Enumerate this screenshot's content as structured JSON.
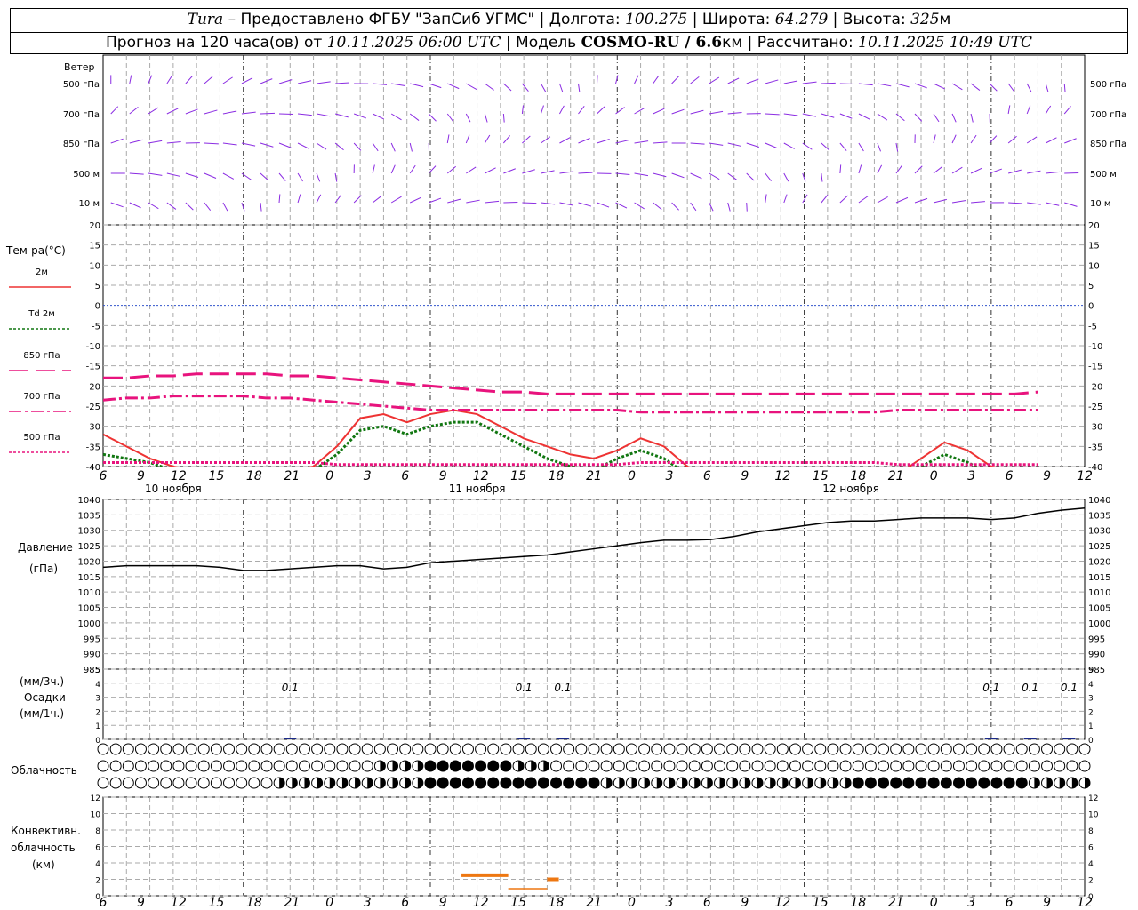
{
  "header": {
    "station": "Tura",
    "provider": " – Предоставлено ФГБУ \"ЗапСиб УГМС\" | Долгота: ",
    "lon": "100.275",
    "lat_label": " | Широта: ",
    "lat": "64.279",
    "alt_label": " | Высота: ",
    "alt": "325",
    "alt_unit": "м",
    "forecast_prefix": "Прогноз на 120 часа(ов) от ",
    "forecast_from": "10.11.2025 06:00 UTC",
    "model_prefix": " | Модель ",
    "model": "COSMO-RU / 6.6",
    "model_unit": "км",
    "calc_prefix": " | Рассчитано: ",
    "calc_time": "10.11.2025 10:49 UTC"
  },
  "colors": {
    "wind": "#8a2be2",
    "t2m": "#ee3333",
    "td2m": "#117711",
    "t850": "#e8137d",
    "t700": "#e8137d",
    "t500": "#e8137d",
    "pressure": "#000000",
    "precip": "#1a2a8a",
    "conv": "#ee7711",
    "grid": "#999999",
    "zero_line": "#3355cc"
  },
  "time_axis": {
    "hours": [
      "6",
      "9",
      "12",
      "15",
      "18",
      "21",
      "0",
      "3",
      "6",
      "9",
      "12",
      "15",
      "18",
      "21",
      "0",
      "3",
      "6",
      "9",
      "12",
      "15",
      "18",
      "21",
      "0",
      "3",
      "6",
      "9",
      "12"
    ],
    "dates": [
      "10 ноября",
      "11 ноября",
      "12 ноября"
    ]
  },
  "wind_panel": {
    "title": "Ветер",
    "levels": [
      "500 гПа",
      "700 гПа",
      "850 гПа",
      "500 м",
      "10  м"
    ]
  },
  "temp_panel": {
    "title": "Тем-ра(°C)",
    "legend": [
      {
        "label": "2м",
        "key": "t2m",
        "style": "solid"
      },
      {
        "label": "Td  2м",
        "key": "td2m",
        "style": "dotted"
      },
      {
        "label": "850 гПа",
        "key": "t850",
        "style": "solid"
      },
      {
        "label": "700 гПа",
        "key": "t700",
        "style": "dashdot"
      },
      {
        "label": "500 гПа",
        "key": "t500",
        "style": "dotted"
      }
    ],
    "yticks": [
      "20",
      "15",
      "10",
      "5",
      "0",
      "-5",
      "-10",
      "-15",
      "-20",
      "-25",
      "-30",
      "-35",
      "-40"
    ]
  },
  "pressure_panel": {
    "title_line1": "Давление",
    "title_line2": "(гПа)",
    "yticks": [
      "1040",
      "1035",
      "1030",
      "1025",
      "1020",
      "1015",
      "1010",
      "1005",
      "1000",
      "995",
      "990",
      "985"
    ]
  },
  "precip_panel": {
    "title_line1": "(мм/3ч.)",
    "title_line2": "Осадки",
    "title_line3": "(мм/1ч.)",
    "yticks": [
      "5",
      "4",
      "3",
      "2",
      "1",
      "0"
    ],
    "labels": [
      "0.1",
      "0.1",
      "0.1",
      "0.1",
      "0.1",
      "0.1"
    ]
  },
  "cloud_panel": {
    "title": "Облачность"
  },
  "conv_panel": {
    "title_line1": "Конвективн.",
    "title_line2": "облачность",
    "title_line3": "(км)",
    "yticks": [
      "12",
      "10",
      "8",
      "6",
      "4",
      "2",
      "0"
    ]
  },
  "chart_data": [
    {
      "type": "line",
      "title": "Тем-ра(°C)",
      "x": [
        0,
        3,
        6,
        9,
        12,
        15,
        18,
        21,
        24,
        27,
        30,
        33,
        36,
        39,
        42,
        45,
        48,
        51,
        54,
        57,
        60,
        63,
        66,
        69,
        72,
        75,
        78,
        81,
        84,
        87,
        90,
        93,
        96,
        99,
        102,
        105,
        108,
        111,
        114,
        117,
        120
      ],
      "ylim": [
        -40,
        20
      ],
      "series": [
        {
          "name": "2м",
          "key": "t2m",
          "values": [
            -32,
            -35,
            -38,
            -40,
            -41,
            -42,
            -42,
            -43,
            -41,
            -40,
            -35,
            -28,
            -27,
            -29,
            -27,
            -26,
            -27,
            -30,
            -33,
            -35,
            -37,
            -38,
            -36,
            -33,
            -35,
            -40,
            -42,
            -43,
            -43,
            -44,
            -44,
            -44,
            -44,
            -44,
            -42,
            -38,
            -34,
            -36,
            -40,
            -41,
            -42
          ]
        },
        {
          "name": "Td  2м",
          "key": "td2m",
          "values": [
            -37,
            -38,
            -39,
            -41,
            -42,
            -43,
            -43,
            -44,
            -42,
            -41,
            -37,
            -31,
            -30,
            -32,
            -30,
            -29,
            -29,
            -32,
            -35,
            -38,
            -40,
            -41,
            -38,
            -36,
            -38,
            -42,
            -44,
            -45,
            -45,
            -46,
            -46,
            -46,
            -46,
            -46,
            -44,
            -40,
            -37,
            -39,
            -42,
            -43,
            -44
          ]
        },
        {
          "name": "850 гПа",
          "key": "t850",
          "values": [
            -18,
            -18,
            -17.5,
            -17.5,
            -17,
            -17,
            -17,
            -17,
            -17.5,
            -17.5,
            -18,
            -18.5,
            -19,
            -19.5,
            -20,
            -20.5,
            -21,
            -21.5,
            -21.5,
            -22,
            -22,
            -22,
            -22,
            -22,
            -22,
            -22,
            -22,
            -22,
            -22,
            -22,
            -22,
            -22,
            -22,
            -22,
            -22,
            -22,
            -22,
            -22,
            -22,
            -22,
            -21.5
          ]
        },
        {
          "name": "700 гПа",
          "key": "t700",
          "values": [
            -23.5,
            -23,
            -23,
            -22.5,
            -22.5,
            -22.5,
            -22.5,
            -23,
            -23,
            -23.5,
            -24,
            -24.5,
            -25,
            -25.5,
            -26,
            -26,
            -26,
            -26,
            -26,
            -26,
            -26,
            -26,
            -26,
            -26.5,
            -26.5,
            -26.5,
            -26.5,
            -26.5,
            -26.5,
            -26.5,
            -26.5,
            -26.5,
            -26.5,
            -26.5,
            -26,
            -26,
            -26,
            -26,
            -26,
            -26,
            -26
          ]
        },
        {
          "name": "500 гПа",
          "key": "t500",
          "values": [
            -39,
            -39,
            -39,
            -39,
            -39,
            -39,
            -39,
            -39,
            -39,
            -39,
            -39.5,
            -39.5,
            -39.5,
            -39.5,
            -39.5,
            -39.5,
            -39.5,
            -39.5,
            -39.5,
            -39.5,
            -39.5,
            -39.5,
            -39.5,
            -39,
            -39,
            -39,
            -39,
            -39,
            -39,
            -39,
            -39,
            -39,
            -39,
            -39,
            -39.5,
            -39.5,
            -39.5,
            -39.5,
            -39.5,
            -39.5,
            -39.5
          ]
        }
      ]
    },
    {
      "type": "line",
      "title": "Давление (гПа)",
      "x": [
        0,
        3,
        6,
        9,
        12,
        15,
        18,
        21,
        24,
        27,
        30,
        33,
        36,
        39,
        42,
        45,
        48,
        51,
        54,
        57,
        60,
        63,
        66,
        69,
        72,
        75,
        78,
        81,
        84,
        87,
        90,
        93,
        96,
        99,
        102,
        105,
        108,
        111,
        114,
        117,
        120
      ],
      "ylim": [
        985,
        1040
      ],
      "series": [
        {
          "name": "Давление",
          "key": "pressure",
          "values": [
            1018,
            1018.5,
            1018.5,
            1018.5,
            1018.5,
            1018,
            1017,
            1017,
            1017.5,
            1018,
            1018.5,
            1018.5,
            1017.5,
            1018,
            1019.5,
            1020,
            1020.5,
            1021,
            1021.5,
            1022,
            1023,
            1024,
            1025,
            1026,
            1026.8,
            1026.8,
            1027,
            1028,
            1029.5,
            1030.5,
            1031.5,
            1032.5,
            1033,
            1033,
            1033.5,
            1034,
            1034,
            1034,
            1033.5,
            1034,
            1035.5,
            1036.5,
            1037.2
          ]
        }
      ]
    },
    {
      "type": "bar",
      "title": "Осадки",
      "x": [
        24,
        54,
        59,
        114,
        119,
        124
      ],
      "values": [
        0.1,
        0.1,
        0.1,
        0.1,
        0.1,
        0.1
      ],
      "ylim": [
        0,
        5
      ]
    },
    {
      "type": "bar",
      "title": "Конвективн. облачность (км)",
      "ylim": [
        0,
        12
      ],
      "segments": [
        {
          "x_start": 46,
          "x_end": 52,
          "value": 2.5
        },
        {
          "x_start": 52,
          "x_end": 57,
          "value": 0
        },
        {
          "x_start": 57,
          "x_end": 58.5,
          "value": 2
        }
      ]
    }
  ]
}
